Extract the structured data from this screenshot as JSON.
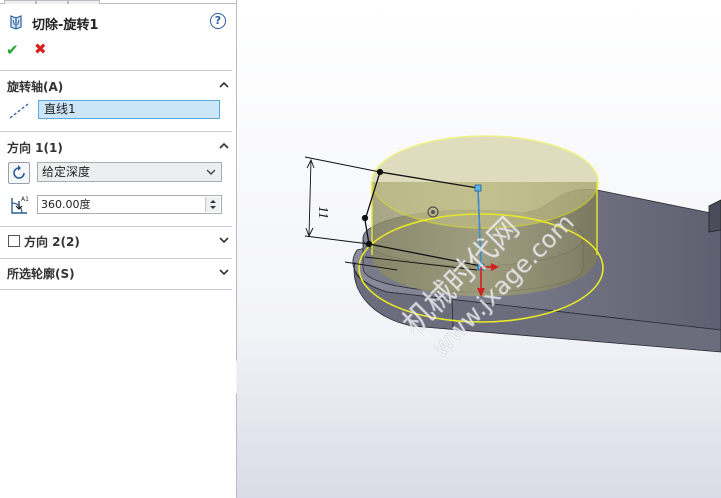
{
  "feature": {
    "title": "切除-旋转1",
    "icon": "cut-revolve-icon",
    "help_symbol": "?"
  },
  "actions": {
    "ok": "✔",
    "cancel": "✖"
  },
  "sections": {
    "axis": {
      "title": "旋转轴(A)",
      "value": "直线1"
    },
    "direction1": {
      "title": "方向 1(1)",
      "end_condition": "给定深度",
      "angle": "360.00度"
    },
    "direction2": {
      "title": "方向 2(2)",
      "checked": false
    },
    "contours": {
      "title": "所选轮廓(S)"
    }
  },
  "viewport": {
    "dimension_label": "11",
    "watermark": "机械时代网",
    "watermark_url": "www.jxage.com"
  },
  "colors": {
    "accent_blue": "#5fa8db",
    "ok_green": "#22a630",
    "cancel_red": "#d8211f",
    "preview_yellow": "#e8e82a",
    "body_gray": "#6f7080"
  }
}
